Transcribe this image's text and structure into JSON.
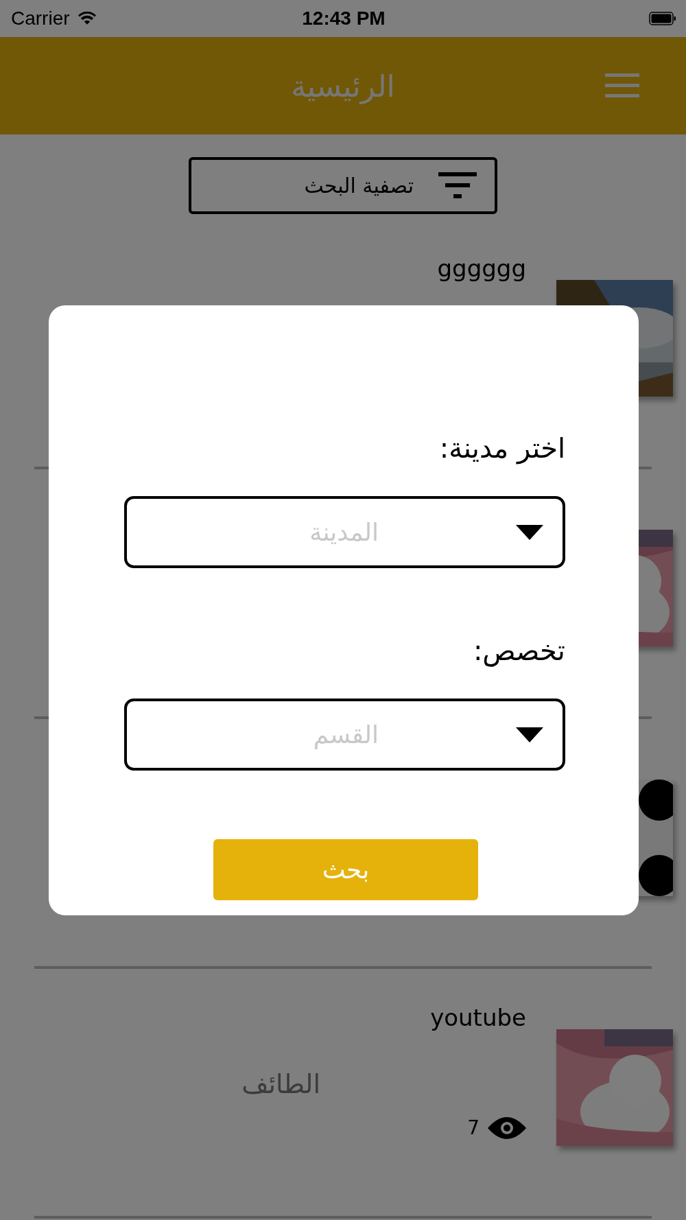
{
  "status_bar": {
    "carrier": "Carrier",
    "time": "12:43 PM"
  },
  "header": {
    "title": "الرئيسية"
  },
  "filter_button": {
    "label": "تصفية البحث"
  },
  "listings": [
    {
      "kind": "picture",
      "title": "gggggg"
    },
    {
      "kind": "picture"
    },
    {
      "kind": "picture"
    },
    {
      "kind": "picture",
      "title": "youtube",
      "city": "الطائف",
      "views": "7"
    }
  ],
  "dialog": {
    "fields": [
      {
        "label": "اختر مدينة:",
        "placeholder": "المدينة"
      },
      {
        "label": "تخصص:",
        "placeholder": "القسم"
      }
    ],
    "button": "بحث"
  }
}
